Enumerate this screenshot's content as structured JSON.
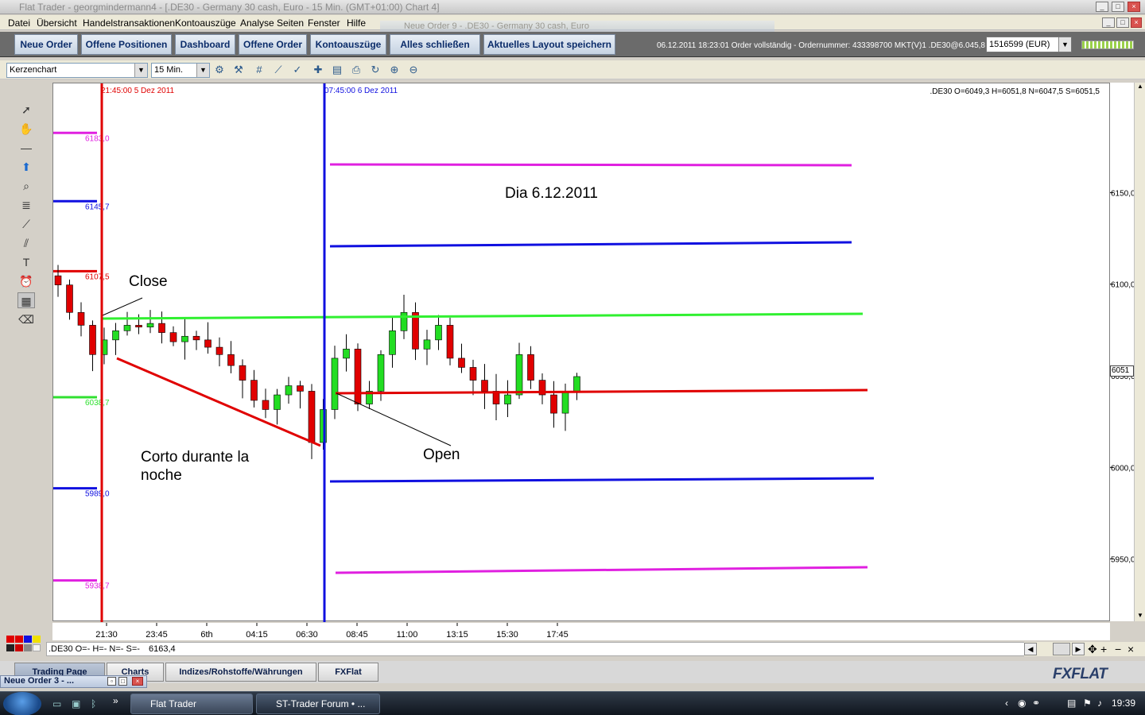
{
  "window": {
    "title": "Flat Trader - georgmindermann4 - [.DE30 - Germany 30 cash, Euro - 15 Min. (GMT+01:00)   Chart 4]"
  },
  "floating_order": {
    "title": "Neue Order 9 - .DE30 - Germany 30 cash, Euro"
  },
  "menu": [
    "Datei",
    "Übersicht",
    "Handelstransaktionen",
    "Kontoauszüge",
    "Analyse Seiten",
    "Fenster",
    "Hilfe"
  ],
  "toolbar": {
    "buttons": [
      "Neue Order",
      "Offene Positionen",
      "Dashboard",
      "Offene Order",
      "Kontoauszüge",
      "Alles schließen",
      "Aktuelles Layout speichern"
    ],
    "status": "06.12.2011 18:23:01 Order vollständig - Ordernummer: 433398700 MKT(V)1 .DE30@6.045,8",
    "account": "1516599 (EUR)"
  },
  "chart_toolbar": {
    "chart_type": "Kerzenchart",
    "timeframe": "15 Min."
  },
  "chart": {
    "ohlc_header": ".DE30 O=6049,3 H=6051,8 N=6047,5 S=6051,5",
    "vline_red_label": "21:45:00 5 Dez 2011",
    "vline_blue_label": "07:45:00 6 Dez 2011",
    "price_tag": "6051",
    "yticks": [
      {
        "label": "6150,0",
        "value": 6150
      },
      {
        "label": "6100,0",
        "value": 6100
      },
      {
        "label": "6050,0",
        "value": 6050
      },
      {
        "label": "6000,0",
        "value": 6000
      },
      {
        "label": "5950,0",
        "value": 5950
      }
    ],
    "xticks": [
      "21:30",
      "23:45",
      "6th",
      "04:15",
      "06:30",
      "08:45",
      "11:00",
      "13:15",
      "15:30",
      "17:45"
    ],
    "levels_left": [
      {
        "label": "6183,0",
        "value": 6183,
        "color": "#e020e0"
      },
      {
        "label": "6145,7",
        "value": 6145.7,
        "color": "#1010e0"
      },
      {
        "label": "6107,5",
        "value": 6107.5,
        "color": "#e00000"
      },
      {
        "label": "6038,7",
        "value": 6038.7,
        "color": "#30e030"
      },
      {
        "label": "5989,0",
        "value": 5989,
        "color": "#1010e0"
      },
      {
        "label": "5938,7",
        "value": 5938.7,
        "color": "#e020e0"
      }
    ],
    "annotations": {
      "title": "Dia 6.12.2011",
      "close": "Close",
      "open": "Open",
      "corto_1": "Corto durante la",
      "corto_2": "noche"
    },
    "colors": {
      "up": "#22dd22",
      "down": "#e00000",
      "magenta": "#e020e0",
      "blue": "#1010e0",
      "green": "#30f030",
      "red": "#e00000"
    }
  },
  "chart_data": {
    "type": "candlestick",
    "x": [
      "21:30",
      "23:45",
      "6th",
      "04:15",
      "06:30",
      "08:45",
      "11:00",
      "13:15",
      "15:30",
      "17:45"
    ],
    "ylim": [
      5916,
      6210
    ],
    "close_series": [
      6100,
      6085,
      6078,
      6062,
      6070,
      6075,
      6078,
      6077,
      6079,
      6074,
      6069,
      6072,
      6070,
      6066,
      6062,
      6056,
      6048,
      6037,
      6032,
      6040,
      6045,
      6042,
      6014,
      6032,
      6060,
      6065,
      6035,
      6042,
      6062,
      6075,
      6085,
      6065,
      6070,
      6078,
      6060,
      6055,
      6048,
      6042,
      6035,
      6040,
      6062,
      6048,
      6040,
      6030,
      6042,
      6050
    ]
  },
  "ohlc_line": {
    "text": ".DE30 O=-  H=-  N=-  S=-",
    "value": "6163,4"
  },
  "tabs": [
    "Trading Page",
    "Charts",
    "Indizes/Rohstoffe/Währungen",
    "FXFlat"
  ],
  "logo": "FXFLAT",
  "minimized_window": "Neue Order 3 - ...",
  "taskbar": {
    "items": [
      "Flat Trader",
      "ST-Trader Forum • ..."
    ],
    "clock": "19:39"
  }
}
